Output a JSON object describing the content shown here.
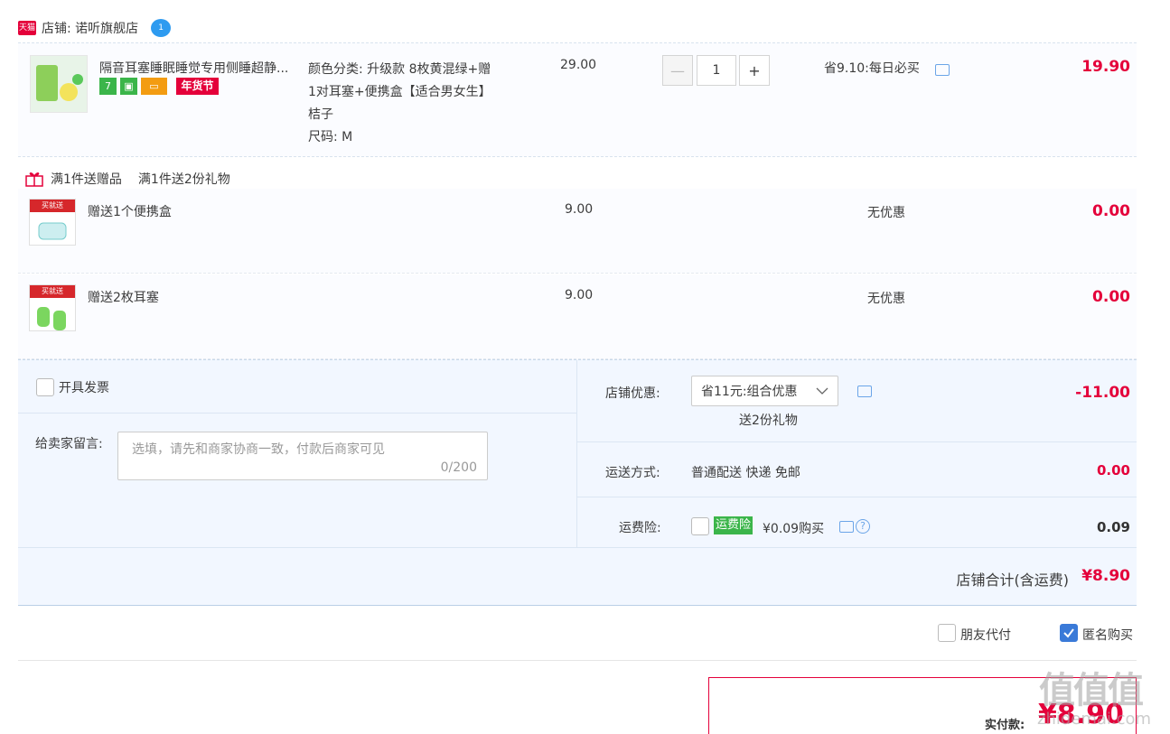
{
  "shop": {
    "name": "店铺: 诺听旗舰店",
    "tmall_badge": "天猫",
    "ww_badge": "1"
  },
  "product": {
    "title": "隔音耳塞睡眠睡觉专用侧睡超静...",
    "tags": [
      "7",
      "年货节"
    ],
    "sku_line1": "颜色分类: 升级款 8枚黄混绿+赠",
    "sku_line2": "1对耳塞+便携盒【适合男女生】",
    "sku_line3": "桔子",
    "sku_size": "尺码: M",
    "price": "29.00",
    "quantity": "1",
    "discount": "省9.10:每日必买",
    "subtotal": "19.90"
  },
  "gifts": {
    "header_label": "满1件送赠品",
    "header_desc": "满1件送2份礼物",
    "items": [
      {
        "name": "赠送1个便携盒",
        "price": "9.00",
        "promo": "无优惠",
        "subtotal": "0.00",
        "thumb_band": "买就送"
      },
      {
        "name": "赠送2枚耳塞",
        "price": "9.00",
        "promo": "无优惠",
        "subtotal": "0.00",
        "thumb_band": "买就送"
      }
    ]
  },
  "order": {
    "invoice_label": "开具发票",
    "message_label": "给卖家留言:",
    "message_placeholder": "选填，请先和商家协商一致，付款后商家可见",
    "message_count": "0/200",
    "shop_discount_label": "店铺优惠:",
    "shop_discount_value": "省11元:组合优惠",
    "shop_discount_note": "送2份礼物",
    "shop_discount_amount": "-11.00",
    "shipping_label": "运送方式:",
    "shipping_value": "普通配送 快递 免邮",
    "shipping_amount": "0.00",
    "insurance_label": "运费险:",
    "insurance_tag": "运费险",
    "insurance_price": "¥0.09购买",
    "insurance_amount": "0.09",
    "total_label": "店铺合计(含运费)",
    "total_value": "¥8.90"
  },
  "options": {
    "friend_pay": "朋友代付",
    "anonymous": "匿名购买"
  },
  "payment": {
    "label": "实付款:",
    "amount": "¥8.90"
  },
  "watermark": "值 什么值得买 zhidemai.com",
  "colors": {
    "accent_red": "#e4003a",
    "summary_bg": "#f2f7ff",
    "check_blue": "#3a7ad8",
    "insure_green": "#3bb54a"
  }
}
